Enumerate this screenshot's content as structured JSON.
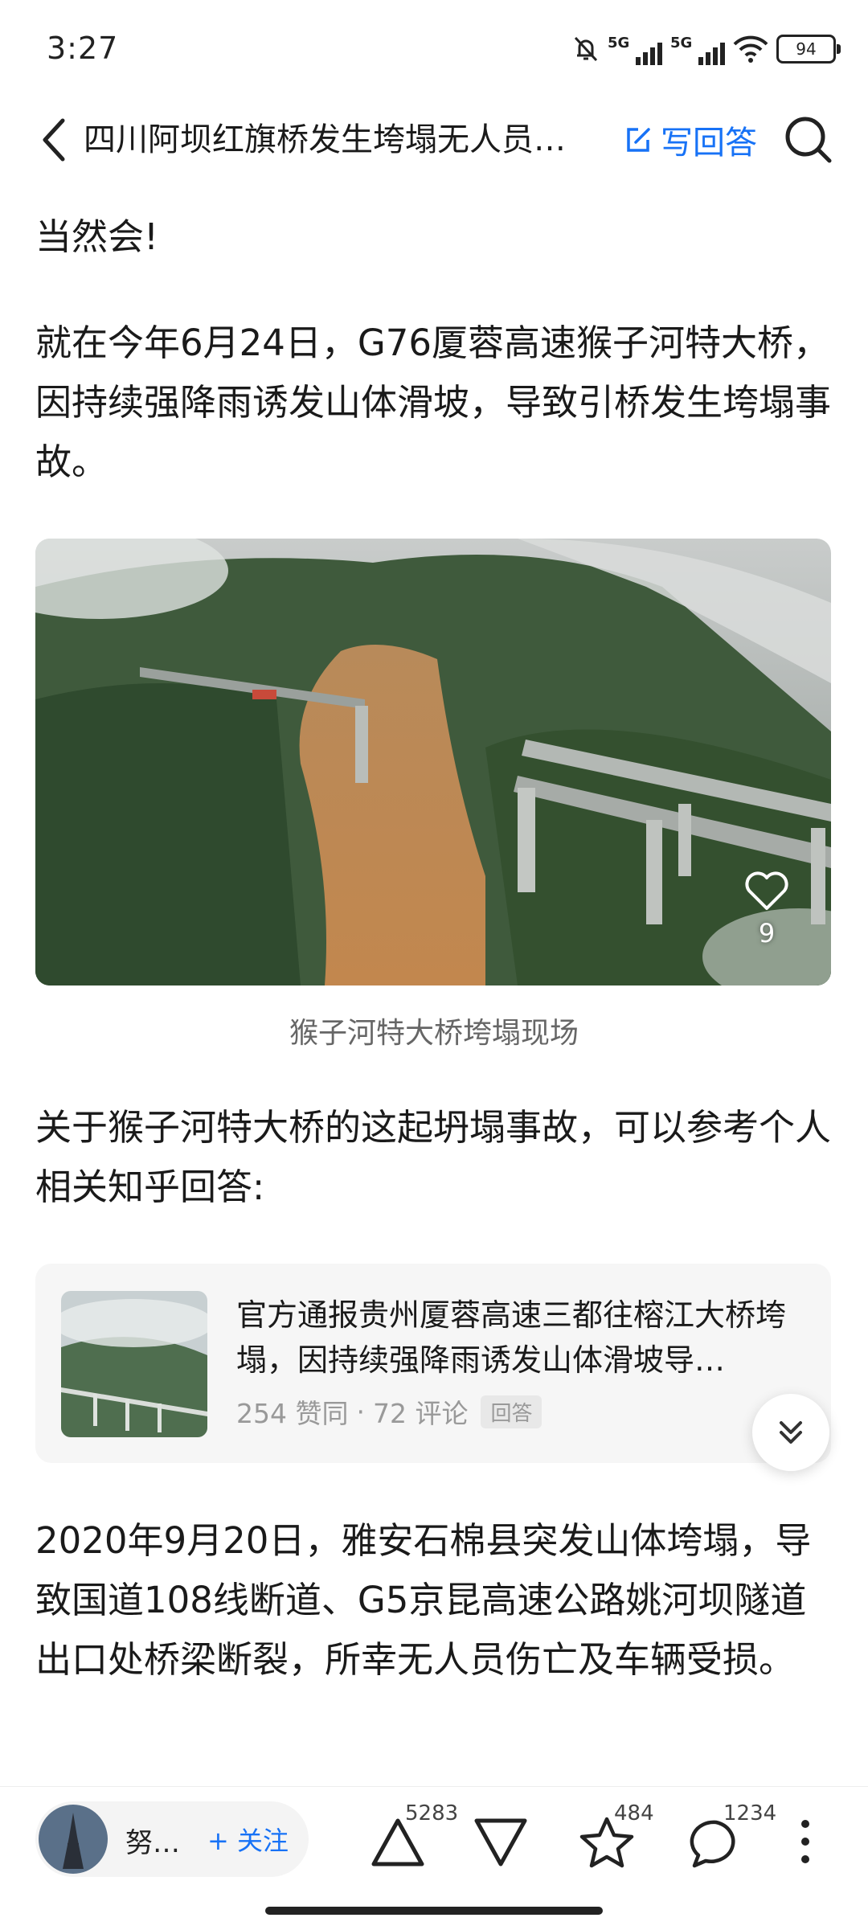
{
  "status_bar": {
    "time": "3:27",
    "network1": "5G",
    "network2": "5G",
    "battery": "94"
  },
  "nav": {
    "title": "四川阿坝红旗桥发生垮塌无人员…",
    "write_answer": "写回答",
    "icons": [
      "back-arrow-icon",
      "edit-icon",
      "search-icon"
    ]
  },
  "article": {
    "p1": "当然会!",
    "p2": "就在今年6月24日，G76厦蓉高速猴子河特大桥，因持续强降雨诱发山体滑坡，导致引桥发生垮塌事故。",
    "image_like_count": "9",
    "image_caption": "猴子河特大桥垮塌现场",
    "p3": "关于猴子河特大桥的这起坍塌事故，可以参考个人相关知乎回答:",
    "p4": "2020年9月20日，雅安石棉县突发山体垮塌，导致国道108线断道、G5京昆高速公路姚河坝隧道出口处桥梁断裂，所幸无人员伤亡及车辆受损。"
  },
  "linked_card": {
    "title": "官方通报贵州厦蓉高速三都往榕江大桥垮塌，因持续强降雨诱发山体滑坡导…",
    "agree": "254 赞同",
    "separator": "·",
    "comments": "72 评论",
    "tag": "回答"
  },
  "bottom_bar": {
    "author_name": "努…",
    "follow": "+ 关注",
    "upvote_count": "5283",
    "favorite_count": "484",
    "comment_count": "1234"
  },
  "colors": {
    "accent": "#1772f6",
    "text": "#1a1a1a",
    "muted": "#999999",
    "card_bg": "#f6f6f6"
  }
}
